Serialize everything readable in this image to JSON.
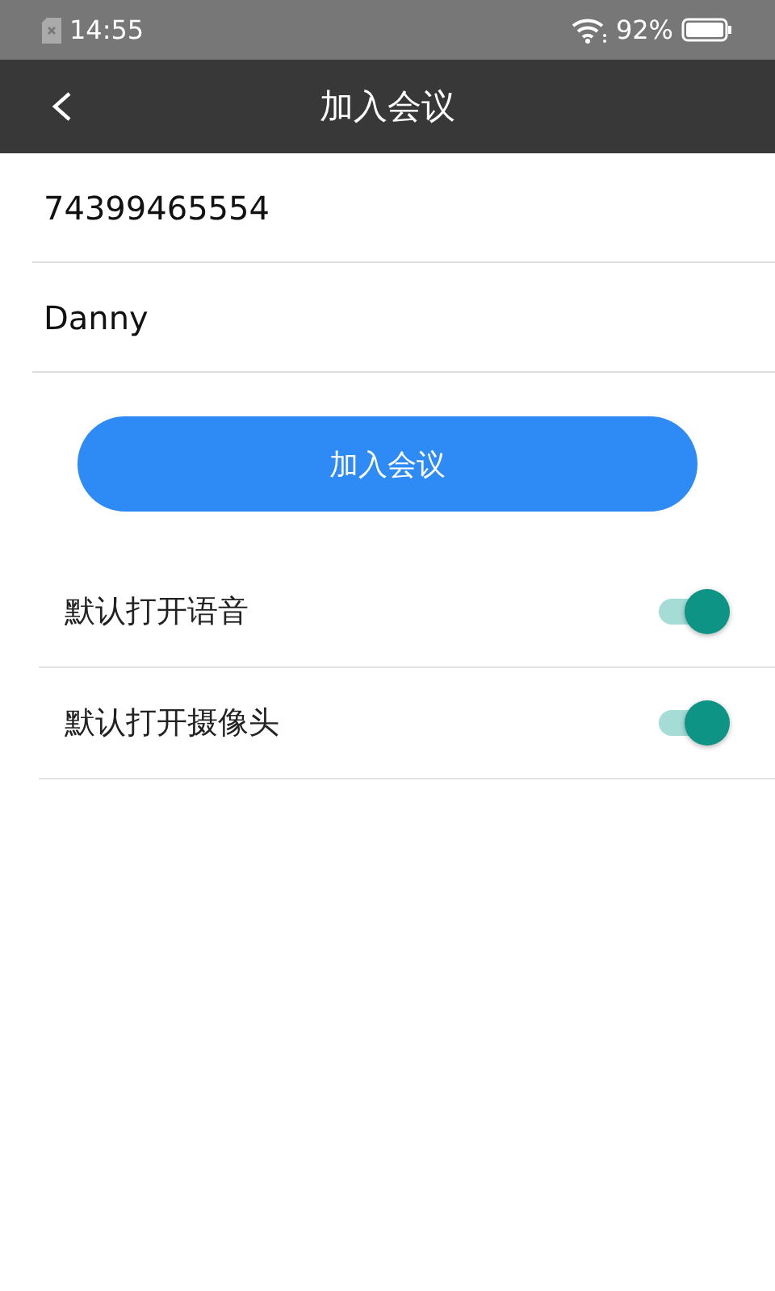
{
  "status_bar": {
    "time": "14:55",
    "battery": "92%"
  },
  "app_bar": {
    "title": "加入会议"
  },
  "fields": [
    {
      "value": "74399465554"
    },
    {
      "value": "Danny"
    }
  ],
  "join_button": {
    "label": "加入会议"
  },
  "settings": [
    {
      "label": "默认打开语音",
      "on": true
    },
    {
      "label": "默认打开摄像头",
      "on": true
    }
  ]
}
